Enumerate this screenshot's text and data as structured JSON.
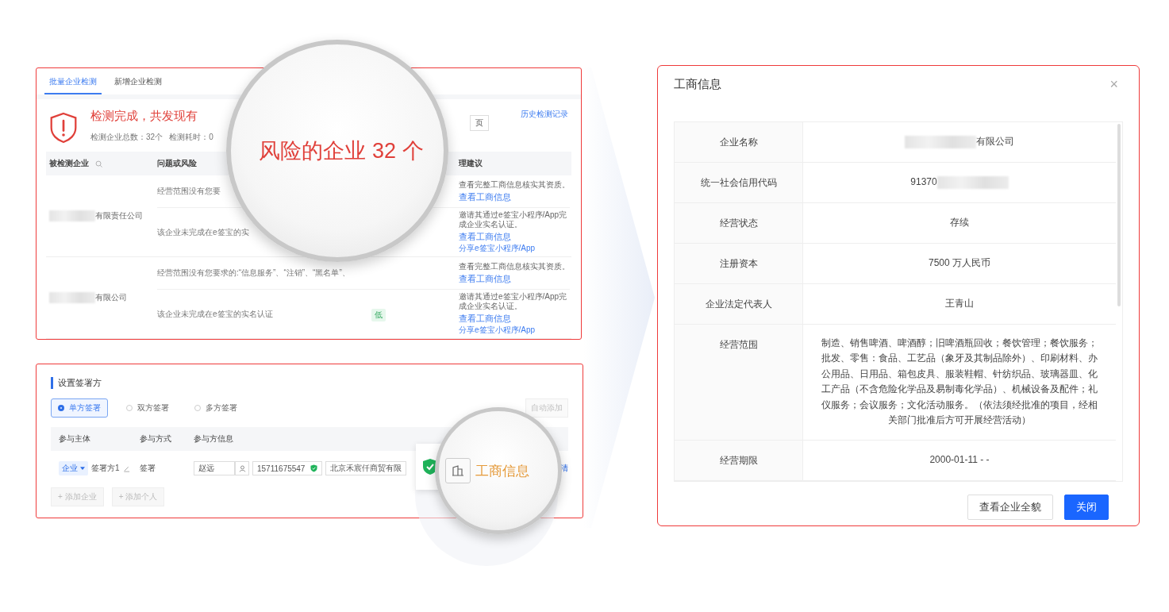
{
  "detect_panel": {
    "tabs": [
      {
        "label": "批量企业检测",
        "selected": true
      },
      {
        "label": "新增企业检测",
        "selected": false
      }
    ],
    "result_title": "检测完成，共发现有",
    "stats": [
      "检测企业总数：32个",
      "检测耗时：0"
    ],
    "page_field": "页",
    "history_link": "历史检测记录",
    "columns": [
      "被检测企业",
      "问题或风险",
      "理建议"
    ],
    "companies": [
      {
        "name": "有限责任公司",
        "issues": [
          {
            "text": "经营范围没有您要",
            "advice": "查看完整工商信息核实其资质。",
            "links": [
              "查看工商信息"
            ]
          },
          {
            "text": "该企业未完成在e签宝的实",
            "advice": "邀请其通过e签宝小程序/App完成企业实名认证。",
            "links": [
              "查看工商信息",
              "分享e签宝小程序/App"
            ]
          }
        ]
      },
      {
        "name": "有限公司",
        "issues": [
          {
            "text": "经营范围没有您要求的:“信息服务”、“注销”、“黑名单”、",
            "advice": "查看完整工商信息核实其资质。",
            "links": [
              "查看工商信息"
            ]
          },
          {
            "text": "该企业未完成在e签宝的实名认证",
            "risk": "低",
            "advice": "邀请其通过e签宝小程序/App完成企业实名认证。",
            "links": [
              "查看工商信息",
              "分享e签宝小程序/App"
            ]
          }
        ]
      }
    ]
  },
  "magnifier_top": {
    "text": "风险的企业 32 个"
  },
  "signer_panel": {
    "title": "设置签署方",
    "modes": [
      {
        "label": "单方签署",
        "selected": true
      },
      {
        "label": "双方签署",
        "selected": false
      },
      {
        "label": "多方签署",
        "selected": false
      }
    ],
    "auto_add": {
      "label": "自动添加",
      "disabled": true
    },
    "columns": [
      "参与主体",
      "参与方式",
      "参与方信息"
    ],
    "row": {
      "type": "企业",
      "signer": "签署方1",
      "method": "签署",
      "name": "赵远",
      "phone": "15711675547",
      "company": "北京禾宸仟商贸有限",
      "action": "清"
    },
    "add_buttons": [
      {
        "label": "+ 添加企业",
        "disabled": true
      },
      {
        "label": "+ 添加个人",
        "disabled": true
      }
    ]
  },
  "magnifier_bottom": {
    "label": "工商信息"
  },
  "modal": {
    "title": "工商信息",
    "close": "×",
    "rows": [
      {
        "kind": "leadmask",
        "label": "企业名称",
        "value": "有限公司"
      },
      {
        "kind": "tailmask",
        "label": "统一社会信用代码",
        "value": "91370"
      },
      {
        "kind": "plain",
        "label": "经营状态",
        "value": "存续"
      },
      {
        "kind": "plain",
        "label": "注册资本",
        "value": "7500 万人民币"
      },
      {
        "kind": "plain",
        "label": "企业法定代表人",
        "value": "王青山"
      },
      {
        "kind": "plain",
        "label": "经营范围",
        "value": "制造、销售啤酒、啤酒醇；旧啤酒瓶回收；餐饮管理；餐饮服务；批发、零售：食品、工艺品（象牙及其制品除外）、印刷材料、办公用品、日用品、箱包皮具、服装鞋帽、针纺织品、玻璃器皿、化工产品（不含危险化学品及易制毒化学品）、机械设备及配件；礼仪服务；会议服务；文化活动服务。（依法须经批准的项目，经相关部门批准后方可开展经营活动）"
      },
      {
        "kind": "plain",
        "label": "经营期限",
        "value": "2000-01-11 - -"
      }
    ],
    "buttons": [
      {
        "label": "查看企业全貌",
        "primary": false
      },
      {
        "label": "关闭",
        "primary": true
      }
    ]
  }
}
